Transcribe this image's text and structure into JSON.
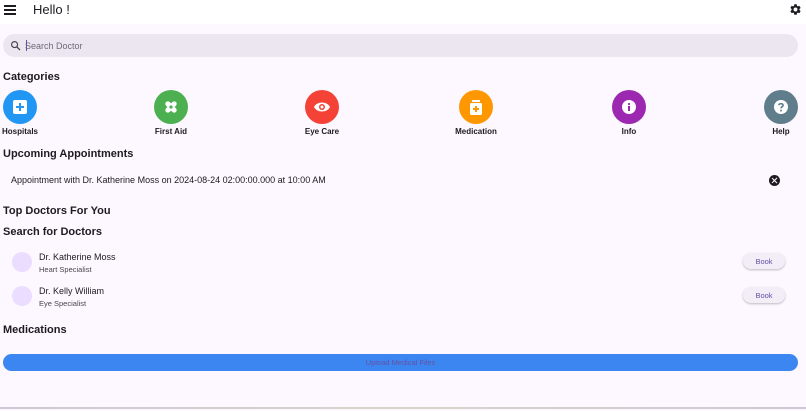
{
  "appbar": {
    "title": "Hello !",
    "menu_icon": "menu-icon",
    "settings_icon": "gear-icon"
  },
  "search": {
    "placeholder": "Search Doctor",
    "value": "",
    "icon": "search-icon"
  },
  "categories": {
    "title": "Categories",
    "items": [
      {
        "label": "Hospitals",
        "icon": "hospital-plus-icon",
        "color": "#2196f3"
      },
      {
        "label": "First Aid",
        "icon": "bandage-icon",
        "color": "#4caf50"
      },
      {
        "label": "Eye Care",
        "icon": "eye-icon",
        "color": "#f44336"
      },
      {
        "label": "Medication",
        "icon": "medication-icon",
        "color": "#ff9800"
      },
      {
        "label": "Info",
        "icon": "info-icon",
        "color": "#9c27b0"
      },
      {
        "label": "Help",
        "icon": "help-icon",
        "color": "#607d8b"
      }
    ]
  },
  "appointments": {
    "title": "Upcoming Appointments",
    "items": [
      {
        "text": "Appointment with Dr. Katherine Moss on 2024-08-24 02:00:00.000 at 10:00 AM"
      }
    ]
  },
  "top_doctors": {
    "title": "Top Doctors For You"
  },
  "search_doctors": {
    "title": "Search for Doctors",
    "doctors": [
      {
        "name": "Dr. Katherine Moss",
        "specialty": "Heart Specialist",
        "book_label": "Book"
      },
      {
        "name": "Dr. Kelly William",
        "specialty": "Eye Specialist",
        "book_label": "Book"
      }
    ]
  },
  "medications": {
    "title": "Medications",
    "upload_label": "Upload Medical Files"
  },
  "colors": {
    "background": "#fdf7ff",
    "primary": "#6750a4",
    "upload_button": "#3b86f0"
  }
}
